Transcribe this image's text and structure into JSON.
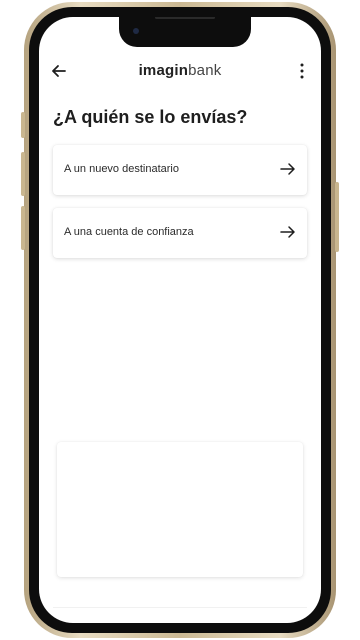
{
  "app": {
    "logo_bold": "imagin",
    "logo_light": "bank"
  },
  "header": {
    "back_icon": "arrow-left-icon",
    "menu_icon": "more-vertical-icon"
  },
  "page": {
    "title": "¿A quién se lo envías?"
  },
  "options": [
    {
      "label": "A un nuevo destinatario",
      "icon": "arrow-right-icon"
    },
    {
      "label": "A una cuenta de confianza",
      "icon": "arrow-right-icon"
    }
  ],
  "colors": {
    "frame_gold": "#cbb994",
    "bezel": "#0d0d0d",
    "text": "#1e1e1e",
    "background": "#ffffff"
  }
}
